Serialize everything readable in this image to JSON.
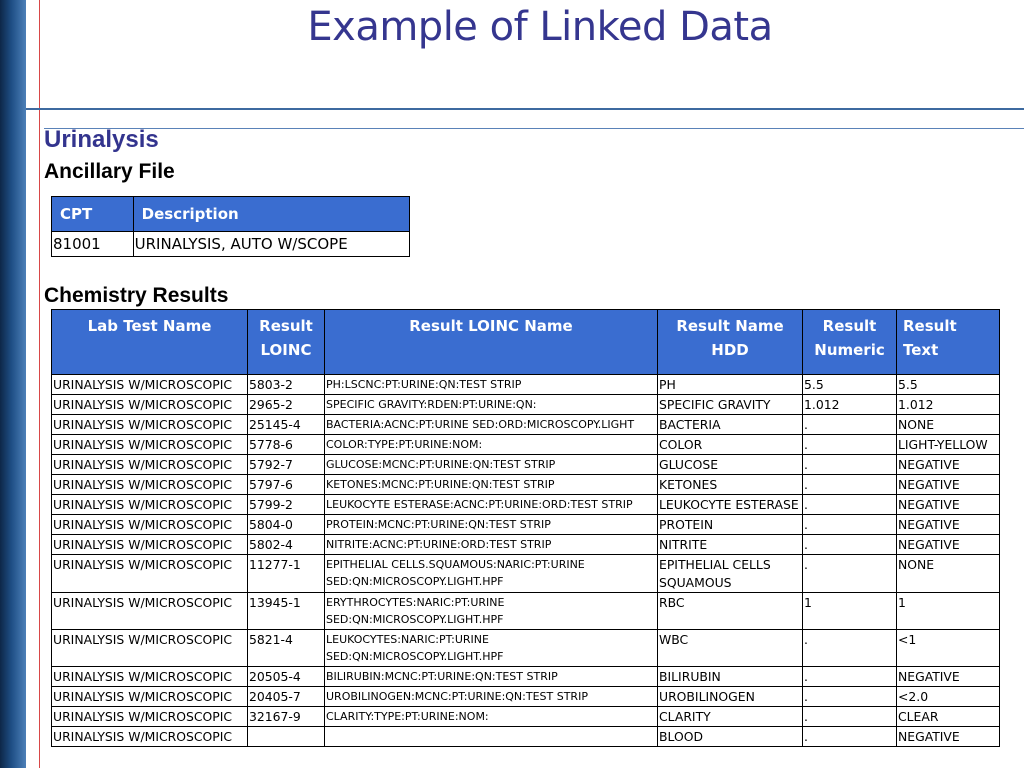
{
  "slide": {
    "title": "Example of Linked Data",
    "section": "Urinalysis",
    "ancillary_heading": "Ancillary File",
    "chemistry_heading": "Chemistry Results"
  },
  "ancillary": {
    "headers": [
      "CPT",
      "Description"
    ],
    "rows": [
      [
        "81001",
        "URINALYSIS, AUTO W/SCOPE"
      ]
    ]
  },
  "chemistry": {
    "headers": [
      "Lab Test Name",
      "Result LOINC",
      "Result LOINC Name",
      "Result Name HDD",
      "Result Numeric",
      "Result Text"
    ],
    "rows": [
      [
        "URINALYSIS W/MICROSCOPIC",
        "5803-2",
        "PH:LSCNC:PT:URINE:QN:TEST STRIP",
        "PH",
        "5.5",
        "5.5"
      ],
      [
        "URINALYSIS W/MICROSCOPIC",
        "2965-2",
        "SPECIFIC GRAVITY:RDEN:PT:URINE:QN:",
        "SPECIFIC GRAVITY",
        "1.012",
        "1.012"
      ],
      [
        "URINALYSIS W/MICROSCOPIC",
        "25145-4",
        "BACTERIA:ACNC:PT:URINE SED:ORD:MICROSCOPY.LIGHT",
        "BACTERIA",
        ".",
        "NONE"
      ],
      [
        "URINALYSIS W/MICROSCOPIC",
        "5778-6",
        "COLOR:TYPE:PT:URINE:NOM:",
        "COLOR",
        ".",
        "LIGHT-YELLOW"
      ],
      [
        "URINALYSIS W/MICROSCOPIC",
        "5792-7",
        "GLUCOSE:MCNC:PT:URINE:QN:TEST STRIP",
        "GLUCOSE",
        ".",
        "NEGATIVE"
      ],
      [
        "URINALYSIS W/MICROSCOPIC",
        "5797-6",
        "KETONES:MCNC:PT:URINE:QN:TEST STRIP",
        "KETONES",
        ".",
        "NEGATIVE"
      ],
      [
        "URINALYSIS W/MICROSCOPIC",
        "5799-2",
        "LEUKOCYTE ESTERASE:ACNC:PT:URINE:ORD:TEST STRIP",
        "LEUKOCYTE ESTERASE",
        ".",
        "NEGATIVE"
      ],
      [
        "URINALYSIS W/MICROSCOPIC",
        "5804-0",
        "PROTEIN:MCNC:PT:URINE:QN:TEST STRIP",
        "PROTEIN",
        ".",
        "NEGATIVE"
      ],
      [
        "URINALYSIS W/MICROSCOPIC",
        "5802-4",
        "NITRITE:ACNC:PT:URINE:ORD:TEST STRIP",
        "NITRITE",
        ".",
        "NEGATIVE"
      ],
      [
        "URINALYSIS W/MICROSCOPIC",
        "11277-1",
        "EPITHELIAL CELLS.SQUAMOUS:NARIC:PT:URINE SED:QN:MICROSCOPY.LIGHT.HPF",
        "EPITHELIAL CELLS SQUAMOUS",
        ".",
        "NONE"
      ],
      [
        "URINALYSIS W/MICROSCOPIC",
        "13945-1",
        "ERYTHROCYTES:NARIC:PT:URINE SED:QN:MICROSCOPY.LIGHT.HPF",
        "RBC",
        "1",
        "1"
      ],
      [
        "URINALYSIS W/MICROSCOPIC",
        "5821-4",
        "LEUKOCYTES:NARIC:PT:URINE SED:QN:MICROSCOPY.LIGHT.HPF",
        "WBC",
        ".",
        "<1"
      ],
      [
        "URINALYSIS W/MICROSCOPIC",
        "20505-4",
        "BILIRUBIN:MCNC:PT:URINE:QN:TEST STRIP",
        "BILIRUBIN",
        ".",
        "NEGATIVE"
      ],
      [
        "URINALYSIS W/MICROSCOPIC",
        "20405-7",
        "UROBILINOGEN:MCNC:PT:URINE:QN:TEST STRIP",
        "UROBILINOGEN",
        ".",
        "<2.0"
      ],
      [
        "URINALYSIS W/MICROSCOPIC",
        "32167-9",
        "CLARITY:TYPE:PT:URINE:NOM:",
        "CLARITY",
        ".",
        "CLEAR"
      ],
      [
        "URINALYSIS W/MICROSCOPIC",
        "",
        "",
        "BLOOD",
        ".",
        "NEGATIVE"
      ]
    ]
  },
  "colors": {
    "title": "#35368f",
    "header_fill": "#3a6dd0",
    "left_bar": "#1f4f86",
    "rule": "#3d6aa0"
  }
}
